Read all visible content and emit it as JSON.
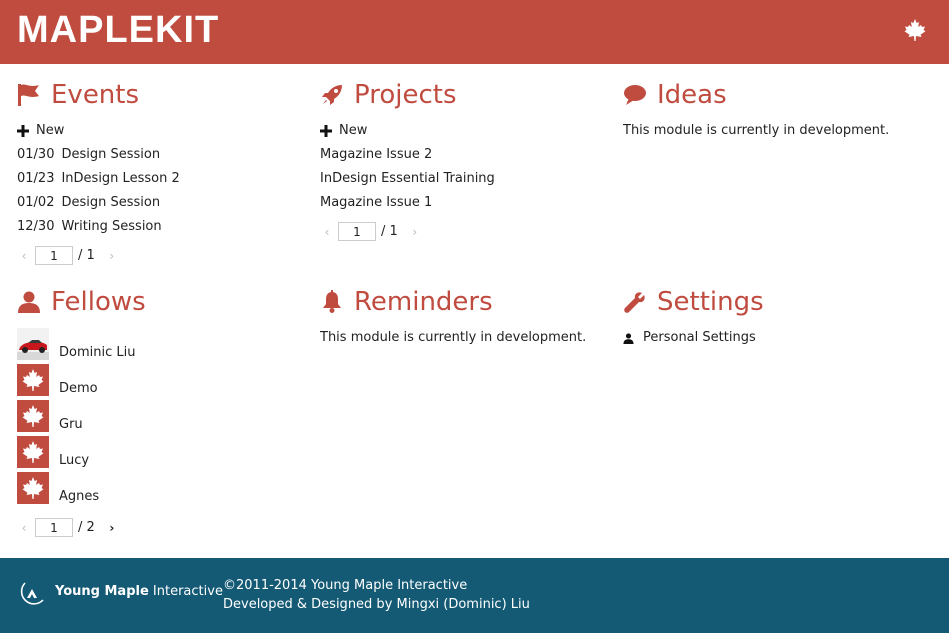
{
  "header": {
    "logo": "MAPLEKIT",
    "leaf_icon": "maple-leaf-icon",
    "bg_color": "#c04c40"
  },
  "events": {
    "title": "Events",
    "icon": "flag-icon",
    "new_label": "New",
    "items": [
      {
        "date": "01/30",
        "name": "Design Session"
      },
      {
        "date": "01/23",
        "name": "InDesign Lesson 2"
      },
      {
        "date": "01/02",
        "name": "Design Session"
      },
      {
        "date": "12/30",
        "name": "Writing Session"
      }
    ],
    "pager": {
      "page": "1",
      "of": "/ 1"
    }
  },
  "projects": {
    "title": "Projects",
    "icon": "rocket-icon",
    "new_label": "New",
    "items": [
      "Magazine Issue 2",
      "InDesign Essential Training",
      "Magazine Issue 1"
    ],
    "pager": {
      "page": "1",
      "of": "/ 1"
    }
  },
  "ideas": {
    "title": "Ideas",
    "icon": "speech-bubble-icon",
    "message": "This module is currently in development."
  },
  "fellows": {
    "title": "Fellows",
    "icon": "user-icon",
    "items": [
      {
        "name": "Dominic Liu",
        "avatar": "car-photo"
      },
      {
        "name": "Demo",
        "avatar": "maple-leaf-icon"
      },
      {
        "name": "Gru",
        "avatar": "maple-leaf-icon"
      },
      {
        "name": "Lucy",
        "avatar": "maple-leaf-icon"
      },
      {
        "name": "Agnes",
        "avatar": "maple-leaf-icon"
      }
    ],
    "pager": {
      "page": "1",
      "of": "/ 2"
    }
  },
  "reminders": {
    "title": "Reminders",
    "icon": "bell-icon",
    "message": "This module is currently in development."
  },
  "settings": {
    "title": "Settings",
    "icon": "wrench-icon",
    "items": [
      {
        "label": "Personal Settings",
        "icon": "user-icon"
      }
    ]
  },
  "footer": {
    "brand_bold": "Young Maple",
    "brand_rest": "Interactive",
    "copyright": "©2011-2014 Young Maple Interactive",
    "credits": "Developed & Designed by Mingxi (Dominic) Liu",
    "bg_color": "#145a75"
  }
}
